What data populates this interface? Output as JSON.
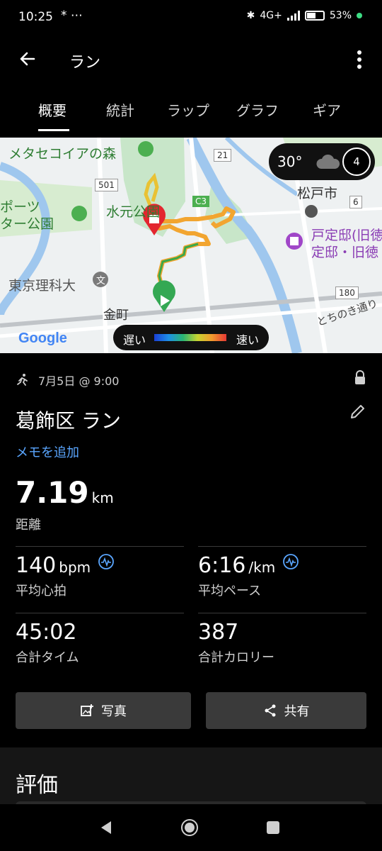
{
  "status_bar": {
    "time": "10:25",
    "notif": "* ⋯",
    "network": "4G+",
    "battery": "53%"
  },
  "app_bar": {
    "title": "ラン"
  },
  "tabs": [
    {
      "label": "概要",
      "active": true
    },
    {
      "label": "統計"
    },
    {
      "label": "ラップ"
    },
    {
      "label": "グラフ"
    },
    {
      "label": "ギア"
    }
  ],
  "map": {
    "labels": {
      "forest": "メタセコイアの森",
      "park1": "水元公園",
      "park2": "ポーツ\nター公園",
      "univ": "東京理科大",
      "town": "金町",
      "city": "松戸市",
      "house": "戸定邸(旧徳\n定邸・旧徳",
      "street": "とちのき通り",
      "route501": "501",
      "route21": "21",
      "route180": "180",
      "routeC3": "C3",
      "route6": "6"
    },
    "weather": {
      "temp": "30°",
      "uv": "4"
    },
    "legend": {
      "slow": "遅い",
      "fast": "速い"
    },
    "logo": "Google"
  },
  "activity": {
    "date": "7月5日 @ 9:00",
    "title": "葛飾区 ラン",
    "memo_link": "メモを追加",
    "distance": {
      "value": "7.19",
      "unit": "km",
      "label": "距離"
    },
    "avg_hr": {
      "value": "140",
      "unit": "bpm",
      "label": "平均心拍"
    },
    "avg_pace": {
      "value": "6:16",
      "unit": "/km",
      "label": "平均ペース"
    },
    "total_time": {
      "value": "45:02",
      "label": "合計タイム"
    },
    "calories": {
      "value": "387",
      "label": "合計カロリー"
    }
  },
  "buttons": {
    "photo": "写真",
    "share": "共有"
  },
  "evaluation": {
    "title": "評価"
  }
}
